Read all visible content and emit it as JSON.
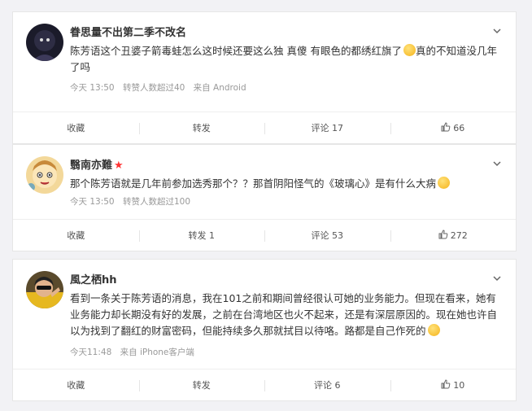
{
  "posts": [
    {
      "username": "眷思量不出第二季不改名",
      "vip": false,
      "content": "陈芳语这个丑婆子箭毒蛙怎么这时候还要这么独 真傻 有眼色的都绣红旗了",
      "content_tail": "真的不知道没几年了吗",
      "time": "今天 13:50",
      "extra": "转赞人数超过40",
      "source": "来自 Android",
      "actions": {
        "collect": "收藏",
        "repost": "转发",
        "comment": "评论 17",
        "like": "66"
      }
    },
    {
      "username": "翳南亦難",
      "vip": true,
      "content": "那个陈芳语就是几年前参加选秀那个？？那首阴阳怪气的《玻璃心》是有什么大病",
      "content_tail": "",
      "time": "今天 13:50",
      "extra": "转赞人数超过100",
      "source": "",
      "actions": {
        "collect": "收藏",
        "repost": "转发 1",
        "comment": "评论 53",
        "like": "272"
      }
    },
    {
      "username": "風之栖hh",
      "vip": false,
      "content": "看到一条关于陈芳语的消息，我在101之前和期间曾经很认可她的业务能力。但现在看来，她有业务能力却长期没有好的发展，之前在台湾地区也火不起来，还是有深层原因的。现在她也许自以为找到了翻红的财富密码，但能持续多久那就拭目以待咯。路都是自己作死的",
      "content_tail": "",
      "time": "今天11:48",
      "extra": "来自 iPhone客户端",
      "source": "",
      "actions": {
        "collect": "收藏",
        "repost": "转发",
        "comment": "评论 6",
        "like": "10"
      }
    }
  ],
  "vip_icon": "star-icon",
  "colors": {
    "vip": "#ff3333",
    "meta": "#999999",
    "background": "#f2f2f5"
  }
}
